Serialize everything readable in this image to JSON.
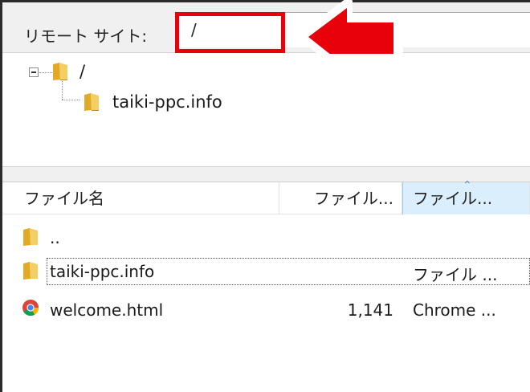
{
  "remote": {
    "label": "リモート サイト:",
    "path": "/"
  },
  "tree": {
    "root_label": "/",
    "child_label": "taiki-ppc.info"
  },
  "columns": {
    "name": "ファイル名",
    "size": "ファイル...",
    "type": "ファイル..."
  },
  "files": [
    {
      "name": "..",
      "size": "",
      "type": "",
      "icon": "folder-icon"
    },
    {
      "name": "taiki-ppc.info",
      "size": "",
      "type": "ファイル ...",
      "icon": "folder-icon"
    },
    {
      "name": "welcome.html",
      "size": "1,141",
      "type": "Chrome ...",
      "icon": "chrome-icon"
    }
  ],
  "colors": {
    "highlight": "#e8000b",
    "folder": "#e6b93c",
    "selected_header": "#dbeefc"
  }
}
